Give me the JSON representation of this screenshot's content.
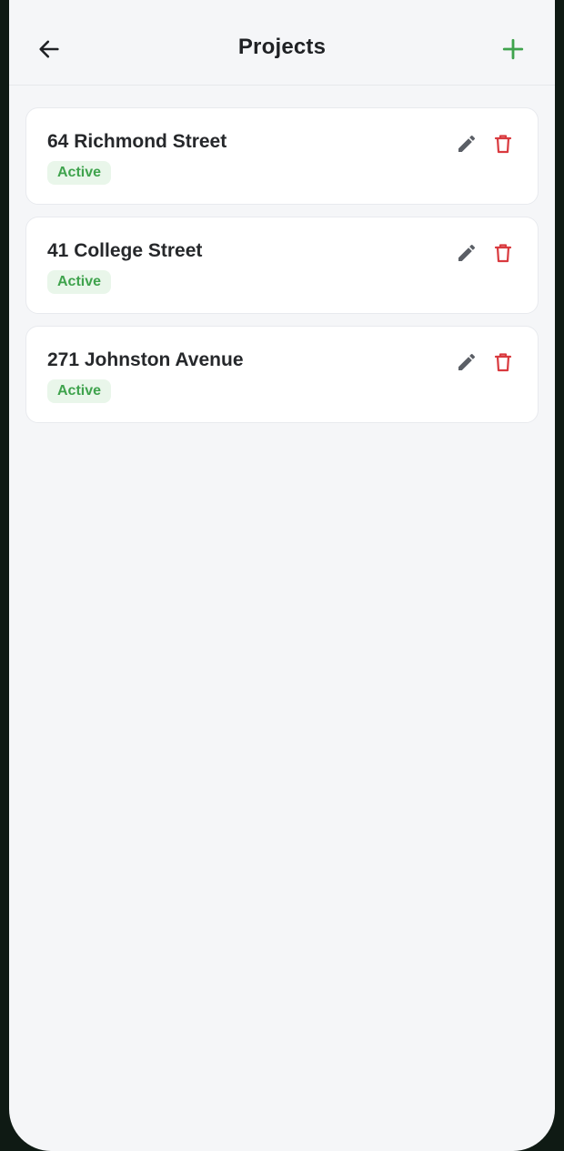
{
  "header": {
    "title": "Projects",
    "back_icon": "arrow-left-icon",
    "add_icon": "plus-icon"
  },
  "projects": [
    {
      "name": "64 Richmond Street",
      "status": "Active"
    },
    {
      "name": "41 College Street",
      "status": "Active"
    },
    {
      "name": "271 Johnston Avenue",
      "status": "Active"
    }
  ],
  "colors": {
    "accent_green": "#3fa34d",
    "badge_bg": "#e9f6ea",
    "delete_red": "#d93a3f",
    "edit_gray": "#5b5f66",
    "background": "#f5f6f8",
    "frame": "#0f1a14"
  },
  "icons": {
    "edit": "pencil-icon",
    "delete": "trash-icon"
  }
}
